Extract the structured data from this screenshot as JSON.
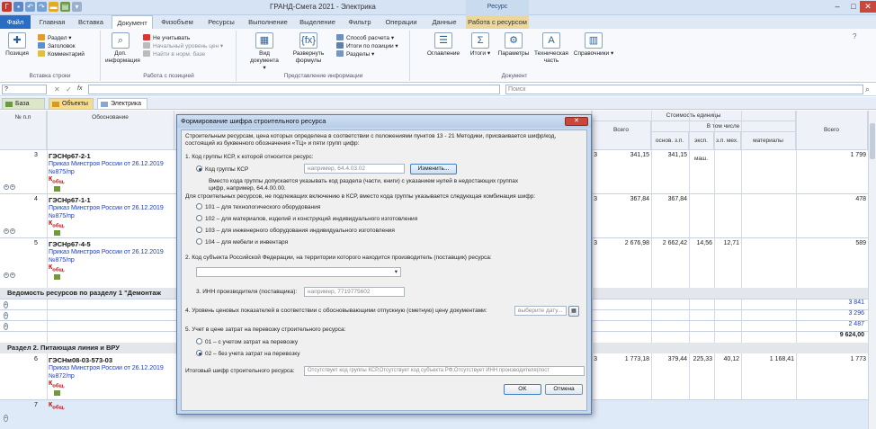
{
  "app": {
    "title": "ГРАНД-Смета 2021 - Электрика",
    "context_group": "Ресурс",
    "window_buttons": [
      "–",
      "□",
      "✕"
    ]
  },
  "ribbon_tabs": [
    "Файл",
    "Главная",
    "Вставка",
    "Документ",
    "Физобъем",
    "Ресурсы",
    "Выполнение",
    "Выделение",
    "Фильтр",
    "Операции",
    "Данные",
    "Работа с ресурсом"
  ],
  "ribbon": {
    "g1": {
      "label": "Вставка строки",
      "pos": "Позиция",
      "razdel": "Раздел",
      "zag": "Заголовок",
      "kom": "Комментарий"
    },
    "g2": {
      "label": "Работа с позицией",
      "dop": "Доп. информация",
      "ne_uch": "Не учитывать",
      "nach_ur": "Начальный уровень цен",
      "nayti": "Найти в норм. базе"
    },
    "g3": {
      "label": "Представление информации",
      "vid": "Вид документа",
      "razv": "Развернуть формулы",
      "sposob": "Способ расчета",
      "itogi_poz": "Итоги по позиции",
      "razdely": "Разделы"
    },
    "g4": {
      "label": "Документ",
      "ogl": "Оглавление",
      "itogi": "Итоги",
      "param": "Параметры",
      "tech": "Техническая часть",
      "sprav": "Справочники"
    }
  },
  "formula_bar": {
    "cell": "?",
    "fx": "fx",
    "search_placeholder": "Поиск"
  },
  "doc_tabs": [
    "База",
    "Объекты",
    "Электрика"
  ],
  "grid": {
    "headers": {
      "num": "№ п.п",
      "osnov": "Обоснование",
      "stoim": "Стоимость единицы",
      "vsego": "Всего",
      "v_tom": "В том числе",
      "osn_zp": "основ. з.п.",
      "eksp": "эксп. маш.",
      "zp_meh": "з.п. мех.",
      "mat": "материалы",
      "vsego2": "Всего"
    },
    "rows": [
      {
        "n": "3",
        "code": "ГЭСНр67-2-1",
        "link1": "Приказ Минстроя России от 26.12.2019",
        "link2": "№875/пр",
        "k": "К",
        "ob": "общ.",
        "vals": [
          "341,15",
          "341,15",
          "",
          "",
          ""
        ],
        "total": "1 799",
        "cut": "3"
      },
      {
        "n": "4",
        "code": "ГЭСНр67-1-1",
        "link1": "Приказ Минстроя России от 26.12.2019",
        "link2": "№875/пр",
        "k": "К",
        "ob": "общ.",
        "vals": [
          "367,84",
          "367,84",
          "",
          "",
          ""
        ],
        "total": "478",
        "cut": "3"
      },
      {
        "n": "5",
        "code": "ГЭСНр67-4-5",
        "link1": "Приказ Минстроя России от 26.12.2019",
        "link2": "№875/пр",
        "k": "К",
        "ob": "общ.",
        "vals": [
          "2 676,98",
          "2 662,42",
          "14,56",
          "12,71",
          ""
        ],
        "total": "589",
        "cut": "3"
      }
    ],
    "section_res": "Ведомость ресурсов по разделу 1 \"Демонтаж",
    "res_totals": [
      "3 841",
      "3 296",
      "2 487",
      "9 624,00"
    ],
    "section2": "Раздел 2. Питающая линия и ВРУ",
    "row6": {
      "n": "6",
      "code": "ГЭСНм08-03-573-03",
      "link1": "Приказ Минстроя России от 26.12.2019",
      "link2": "№872/пр",
      "k": "К",
      "ob": "общ.",
      "vals": [
        "1 773,18",
        "379,44",
        "225,33",
        "40,12",
        "1 168,41"
      ],
      "total": "1 773",
      "cut": "3"
    },
    "row7": {
      "n": "7",
      "k": "К",
      "ob": "общ."
    }
  },
  "dialog": {
    "title": "Формирование шифра строительного ресурса",
    "close": "✕",
    "intro1": "Строительным ресурсам, цена которых определена в соответствии с положениями пунктов 13 - 21 Методики, присваивается шифр/код,",
    "intro2": "состоящий из буквенного обозначения «ТЦ» и пяти групп цифр:",
    "s1": "1. Код группы КСР, к которой относится ресурс:",
    "ksr_radio": "Код группы КСР",
    "ksr_placeholder": "например, 64.4.03.02",
    "change_btn": "Изменить...",
    "note1": "Вместо кода группы допускается указывать код раздела (части, книги) с указанием нулей в недостающих группах",
    "note2": "цифр, например, 64.4.00.00.",
    "note3": "Для строительных ресурсов, не подлежащих включению в КСР, вместо кода группы указывается следующая комбинация шифр:",
    "opt101": "101 – для технологического оборудования",
    "opt102": "102 – для материалов, изделий и конструкций индивидуального изготовления",
    "opt103": "103 – для инженерного оборудования индивидуального изготовления",
    "opt104": "104 – для мебели и инвентаря",
    "s2": "2. Код субъекта Российской Федерации, на территории которого находится производитель (поставщик) ресурса:",
    "s3": "3. ИНН производителя (поставщика):",
    "inn_placeholder": "например, 7719775602",
    "s4": "4. Уровень ценовых показателей в соответствии с обосновывающими отпускную (сметную) цену документами:",
    "date_placeholder": "выберите дату...",
    "s5": "5. Учет в цене затрат на перевозку строительного ресурса:",
    "opt01": "01 – с учетом затрат на перевозку",
    "opt02": "02 – без учета затрат на перевозку",
    "result_label": "Итоговый шифр строительного ресурса:",
    "result_value": "Отсутствует код группы КСР,Отсутствует код субъекта РФ,Отсутствует ИНН производителя(пост",
    "ok": "OK",
    "cancel": "Отмена"
  }
}
